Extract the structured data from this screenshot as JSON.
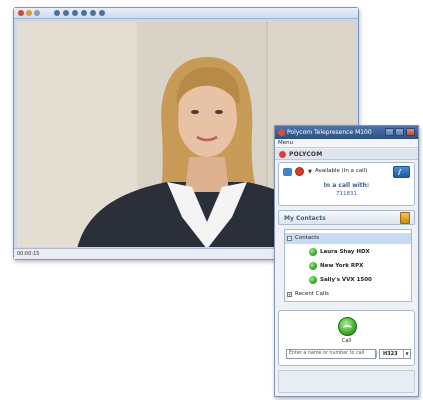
{
  "video_window": {
    "status_text": "00:00:15",
    "titlebar_buttons": [
      "red",
      "orange",
      "gray"
    ],
    "colors": {
      "skin": "#e8c2a4",
      "hair": "#c79a56",
      "jacket": "#2b2f39",
      "shirt": "#f4f4f4",
      "wall": "#d9d2c6",
      "wall_light": "#ebe5da"
    }
  },
  "client": {
    "title": "Polycom Telepresence M100",
    "menu": "Menu",
    "brand": "POLYCOM",
    "status": {
      "availability": "Available (In a call)",
      "in_call_label": "In a call with:",
      "in_call_number": "711831"
    },
    "contacts_header": "My Contacts",
    "groups": {
      "contacts": "Contacts",
      "recent": "Recent Calls"
    },
    "contacts": [
      {
        "name": "Laura Shay HDX"
      },
      {
        "name": "New York RPX"
      },
      {
        "name": "Sally's VVX 1500"
      }
    ],
    "call_button_label": "Call",
    "dial_placeholder": "Enter a name or number to call",
    "protocol": "H323",
    "accent": "#3a5f8c",
    "presence_color": "#3aa42a"
  }
}
